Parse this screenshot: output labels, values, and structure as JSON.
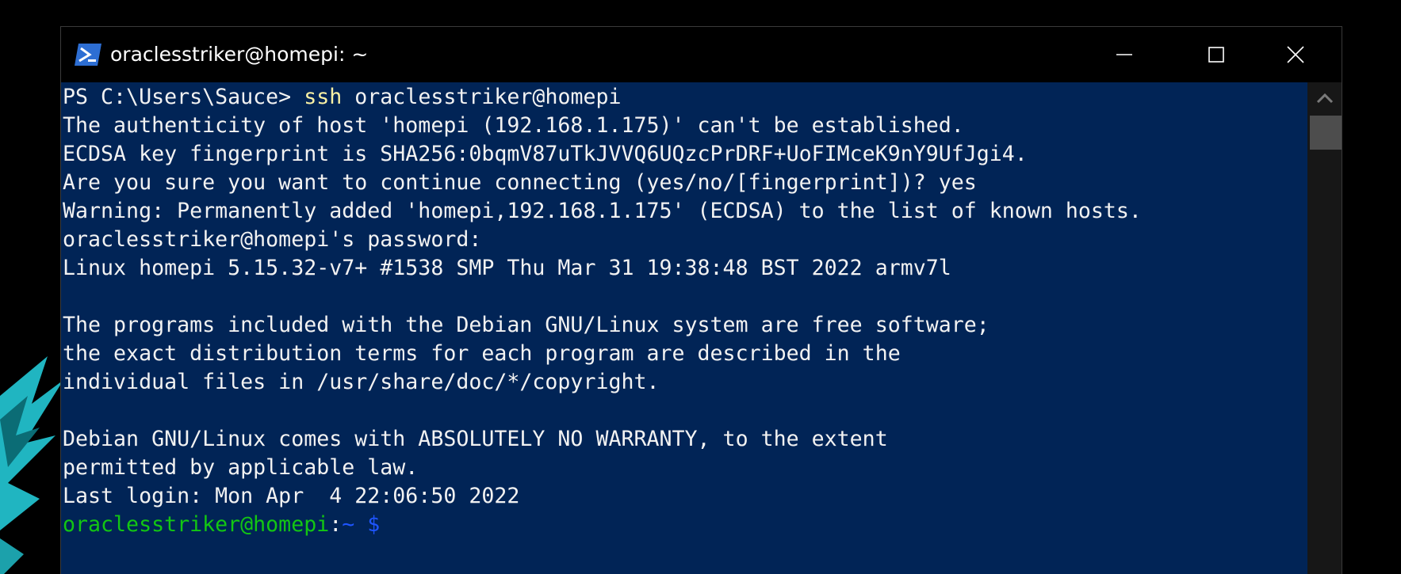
{
  "window": {
    "title": "oraclesstriker@homepi: ~",
    "accent": "#012456"
  },
  "caption_buttons": {
    "minimize": "minimize-icon",
    "maximize": "maximize-icon",
    "close": "close-icon"
  },
  "console": {
    "lines": [
      [
        {
          "text": "PS C:\\Users\\Sauce> ",
          "color": "#f2f2f2"
        },
        {
          "text": "ssh",
          "color": "#f9f1a5"
        },
        {
          "text": " oraclesstriker@homepi",
          "color": "#f2f2f2"
        }
      ],
      [
        {
          "text": "The authenticity of host 'homepi (192.168.1.175)' can't be established.",
          "color": "#f2f2f2"
        }
      ],
      [
        {
          "text": "ECDSA key fingerprint is SHA256:0bqmV87uTkJVVQ6UQzcPrDRF+UoFIMceK9nY9UfJgi4.",
          "color": "#f2f2f2"
        }
      ],
      [
        {
          "text": "Are you sure you want to continue connecting (yes/no/[fingerprint])? yes",
          "color": "#f2f2f2"
        }
      ],
      [
        {
          "text": "Warning: Permanently added 'homepi,192.168.1.175' (ECDSA) to the list of known hosts.",
          "color": "#f2f2f2"
        }
      ],
      [
        {
          "text": "oraclesstriker@homepi's password:",
          "color": "#f2f2f2"
        }
      ],
      [
        {
          "text": "Linux homepi 5.15.32-v7+ #1538 SMP Thu Mar 31 19:38:48 BST 2022 armv7l",
          "color": "#f2f2f2"
        }
      ],
      [
        {
          "text": "",
          "color": "#f2f2f2"
        }
      ],
      [
        {
          "text": "The programs included with the Debian GNU/Linux system are free software;",
          "color": "#f2f2f2"
        }
      ],
      [
        {
          "text": "the exact distribution terms for each program are described in the",
          "color": "#f2f2f2"
        }
      ],
      [
        {
          "text": "individual files in /usr/share/doc/*/copyright.",
          "color": "#f2f2f2"
        }
      ],
      [
        {
          "text": "",
          "color": "#f2f2f2"
        }
      ],
      [
        {
          "text": "Debian GNU/Linux comes with ABSOLUTELY NO WARRANTY, to the extent",
          "color": "#f2f2f2"
        }
      ],
      [
        {
          "text": "permitted by applicable law.",
          "color": "#f2f2f2"
        }
      ],
      [
        {
          "text": "Last login: Mon Apr  4 22:06:50 2022",
          "color": "#f2f2f2"
        }
      ],
      [
        {
          "text": "oraclesstriker@homepi",
          "color": "#13c613"
        },
        {
          "text": ":",
          "color": "#f2f2f2"
        },
        {
          "text": "~ $",
          "color": "#1e55ff"
        }
      ]
    ]
  },
  "scrollbar": {
    "up_icon": "chevron-up-icon"
  }
}
